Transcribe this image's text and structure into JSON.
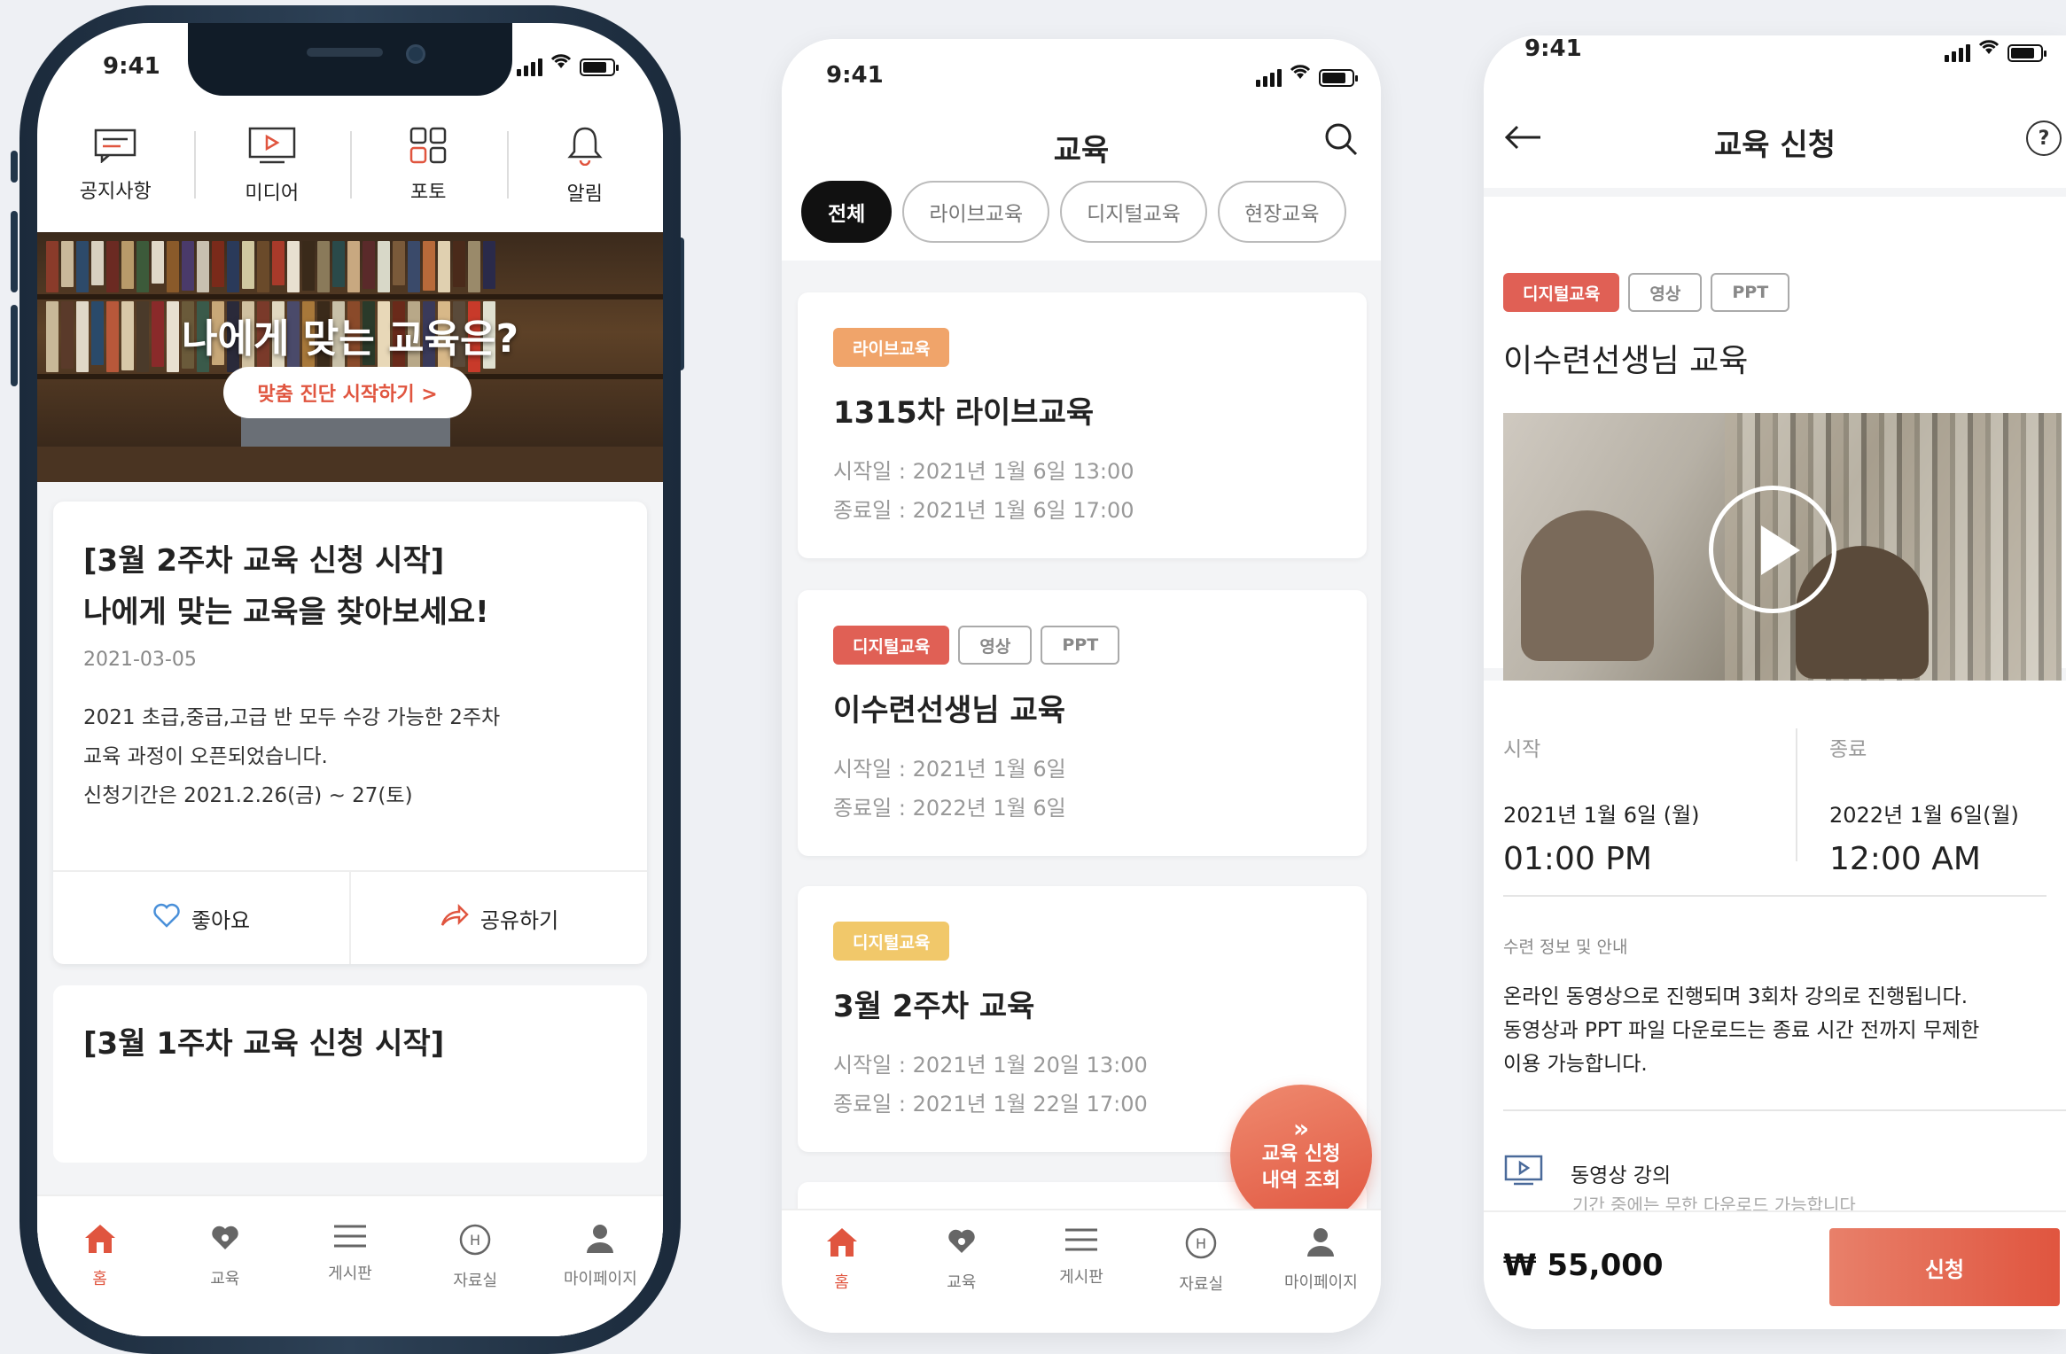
{
  "statusbar": {
    "time": "9:41"
  },
  "colors": {
    "accent": "#e0553f",
    "live_tag": "#f0a46a",
    "digital_tag": "#e06055",
    "digital_tag_alt": "#f1c86a"
  },
  "screen_home": {
    "quick_menu": [
      {
        "label": "공지사항",
        "icon": "notice-icon"
      },
      {
        "label": "미디어",
        "icon": "media-icon"
      },
      {
        "label": "포토",
        "icon": "photo-grid-icon"
      },
      {
        "label": "알림",
        "icon": "bell-icon"
      }
    ],
    "hero": {
      "title": "나에게 맞는 교육은?",
      "button": "맞춤 진단 시작하기  >"
    },
    "notice_card": {
      "title_line1": "[3월 2주차 교육 신청 시작]",
      "title_line2": "나에게 맞는 교육을 찾아보세요!",
      "date": "2021-03-05",
      "body_line1": "2021 초급,중급,고급 반 모두 수강 가능한 2주차",
      "body_line2": "교육 과정이 오픈되었습니다.",
      "body_line3": "신청기간은 2021.2.26(금) ~ 27(토)",
      "like": "좋아요",
      "share": "공유하기"
    },
    "notice_card2": {
      "title": "[3월 1주차 교육 신청 시작]"
    }
  },
  "tabbar": [
    {
      "label": "홈",
      "icon": "home-icon"
    },
    {
      "label": "교육",
      "icon": "education-icon"
    },
    {
      "label": "게시판",
      "icon": "board-icon"
    },
    {
      "label": "자료실",
      "icon": "archive-icon"
    },
    {
      "label": "마이페이지",
      "icon": "user-icon"
    }
  ],
  "screen_edu": {
    "title": "교육",
    "filters": [
      "전체",
      "라이브교육",
      "디지털교육",
      "현장교육"
    ],
    "cards": [
      {
        "tags": [
          "라이브교육"
        ],
        "title": "1315차 라이브교육",
        "start": "시작일 : 2021년 1월 6일 13:00",
        "end": "종료일 : 2021년 1월 6일 17:00"
      },
      {
        "tags": [
          "디지털교육",
          "영상",
          "PPT"
        ],
        "title": "이수련선생님 교육",
        "start": "시작일 : 2021년 1월 6일",
        "end": "종료일 : 2022년 1월 6일"
      },
      {
        "tags": [
          "디지털교육"
        ],
        "title": "3월 2주차 교육",
        "start": "시작일 : 2021년 1월 20일 13:00",
        "end": "종료일 : 2021년 1월 22일 17:00"
      }
    ],
    "fab": {
      "arrows": "»",
      "line1": "교육 신청",
      "line2": "내역 조회"
    }
  },
  "screen_apply": {
    "title": "교육 신청",
    "help": "?",
    "tags": [
      "디지털교육",
      "영상",
      "PPT"
    ],
    "course_title": "이수련선생님 교육",
    "start_label": "시작",
    "start_date": "2021년 1월 6일 (월)",
    "start_time": "01:00 PM",
    "end_label": "종료",
    "end_date": "2022년 1월 6일(월)",
    "end_time": "12:00 AM",
    "info_label": "수련 정보 및 안내",
    "info_line1": "온라인 동영상으로 진행되며 3회차 강의로 진행됩니다.",
    "info_line2": "동영상과 PPT 파일 다운로드는 종료 시간 전까지 무제한",
    "info_line3": "이용 가능합니다.",
    "lecture_label": "동영상 강의",
    "lecture_sub": "기간 중에는 무한 다운로드 가능합니다",
    "price": "₩ 55,000",
    "apply_button": "신청"
  }
}
